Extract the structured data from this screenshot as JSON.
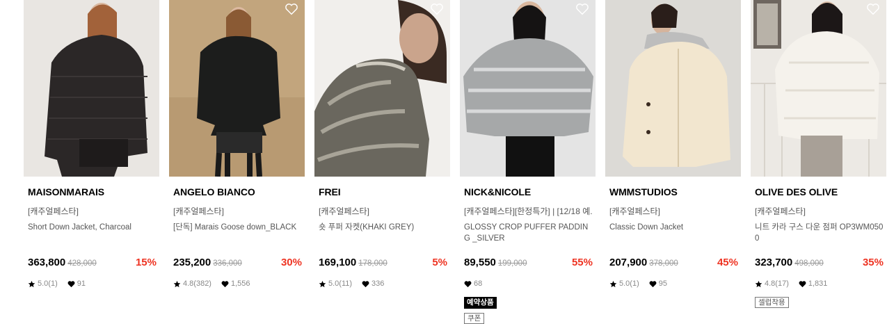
{
  "products": [
    {
      "brand": "MAISONMARAIS",
      "category": "[캐주얼페스타]",
      "title": "Short Down Jacket, Charcoal",
      "price": "363,800",
      "original_price": "428,000",
      "discount": "15%",
      "rating": "5.0(1)",
      "likes": "91",
      "badges": []
    },
    {
      "brand": "ANGELO BIANCO",
      "category": "[캐주얼페스타]",
      "title": "[단독] Marais Goose down_BLACK",
      "price": "235,200",
      "original_price": "336,000",
      "discount": "30%",
      "rating": "4.8(382)",
      "likes": "1,556",
      "badges": []
    },
    {
      "brand": "FREI",
      "category": "[캐주얼페스타]",
      "title": "숏 푸퍼 자켓(KHAKI GREY)",
      "price": "169,100",
      "original_price": "178,000",
      "discount": "5%",
      "rating": "5.0(11)",
      "likes": "336",
      "badges": []
    },
    {
      "brand": "NICK&NICOLE",
      "category": "[캐주얼페스타][한정특가] | [12/18 예...",
      "title": "GLOSSY CROP PUFFER PADDING _SILVER",
      "price": "89,550",
      "original_price": "199,000",
      "discount": "55%",
      "rating": "",
      "likes": "68",
      "badges": [
        "예약상품",
        "쿠폰"
      ]
    },
    {
      "brand": "WMMSTUDIOS",
      "category": "[캐주얼페스타]",
      "title": "Classic Down Jacket",
      "price": "207,900",
      "original_price": "378,000",
      "discount": "45%",
      "rating": "5.0(1)",
      "likes": "95",
      "badges": []
    },
    {
      "brand": "OLIVE DES OLIVE",
      "category": "[캐주얼페스타]",
      "title": "니트 카라 구스 다운 점퍼 OP3WM0500",
      "price": "323,700",
      "original_price": "498,000",
      "discount": "35%",
      "rating": "4.8(17)",
      "likes": "1,831",
      "badges": [
        "셀럽착용"
      ]
    }
  ],
  "colors": {
    "discount": "#ee3322",
    "price": "#000000",
    "muted": "#888888"
  },
  "icons": {
    "wishlist": "heart-outline-icon",
    "rating": "star-icon",
    "likes": "heart-icon"
  }
}
